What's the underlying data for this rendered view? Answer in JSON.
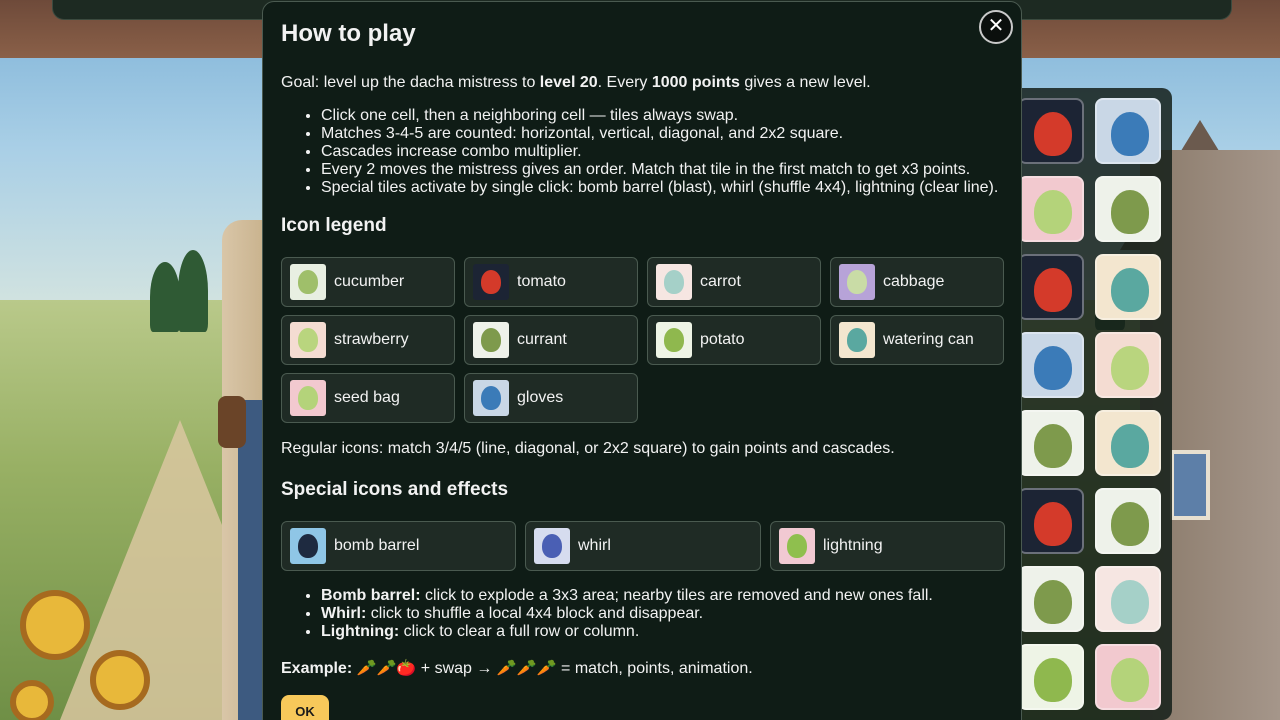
{
  "modal": {
    "title": "How to play",
    "close_label": "✕",
    "goal": {
      "prefix": "Goal: level up the dacha mistress to ",
      "level": "level 20",
      "middle": ". Every ",
      "points": "1000 points",
      "suffix": " gives a new level."
    },
    "rules": [
      "Click one cell, then a neighboring cell — tiles always swap.",
      "Matches 3-4-5 are counted: horizontal, vertical, diagonal, and 2x2 square.",
      "Cascades increase combo multiplier.",
      "Every 2 moves the mistress gives an order. Match that tile in the first match to get x3 points.",
      "Special tiles activate by single click: bomb barrel (blast), whirl (shuffle 4x4), lightning (clear line)."
    ],
    "legend_title": "Icon legend",
    "legend": [
      {
        "label": "cucumber",
        "bg": "#e8efe2",
        "color": "#9fbf6a",
        "icon": "cucumber-icon"
      },
      {
        "label": "tomato",
        "bg": "#1c2434",
        "color": "#d43a2a",
        "icon": "tomato-icon"
      },
      {
        "label": "carrot",
        "bg": "#f6e6e2",
        "color": "#a5d0c8",
        "icon": "carrot-icon"
      },
      {
        "label": "cabbage",
        "bg": "#b7a3d8",
        "color": "#c9dca6",
        "icon": "cabbage-icon"
      },
      {
        "label": "strawberry",
        "bg": "#f4dcd2",
        "color": "#b9d57e",
        "icon": "strawberry-icon"
      },
      {
        "label": "currant",
        "bg": "#eef2ea",
        "color": "#7e9a4c",
        "icon": "currant-icon"
      },
      {
        "label": "potato",
        "bg": "#eef4e6",
        "color": "#8fb84e",
        "icon": "potato-icon"
      },
      {
        "label": "watering can",
        "bg": "#f3e6cf",
        "color": "#5aa8a0",
        "icon": "watering-can-icon"
      },
      {
        "label": "seed bag",
        "bg": "#f2c9cf",
        "color": "#b4d37a",
        "icon": "seed-bag-icon"
      },
      {
        "label": "gloves",
        "bg": "#c9d7e6",
        "color": "#3b7bb8",
        "icon": "gloves-icon"
      }
    ],
    "regular_text": "Regular icons: match 3/4/5 (line, diagonal, or 2x2 square) to gain points and cascades.",
    "special_title": "Special icons and effects",
    "specials": [
      {
        "label": "bomb barrel",
        "bg": "#8fc6e6",
        "color": "#1e2a40",
        "icon": "bomb-barrel-icon"
      },
      {
        "label": "whirl",
        "bg": "#d6dcef",
        "color": "#4a5fb4",
        "icon": "whirl-icon"
      },
      {
        "label": "lightning",
        "bg": "#f1c9d2",
        "color": "#8fbf4e",
        "icon": "lightning-icon"
      }
    ],
    "effects": [
      {
        "name": "Bomb barrel:",
        "text": " click to explode a 3x3 area; nearby tiles are removed and new ones fall."
      },
      {
        "name": "Whirl:",
        "text": " click to shuffle a local 4x4 block and disappear."
      },
      {
        "name": "Lightning:",
        "text": " click to clear a full row or column."
      }
    ],
    "example": {
      "label": "Example:",
      "before": " 🥕🥕🍅 + swap → 🥕🥕🥕 = match, points, animation."
    },
    "ok_label": "OK"
  },
  "board_tiles": [
    {
      "icon": "tomato-icon",
      "bg": "#1c2434",
      "color": "#d43a2a"
    },
    {
      "icon": "gloves-icon",
      "bg": "#c9d7e6",
      "color": "#3b7bb8"
    },
    {
      "icon": "seed-bag-icon",
      "bg": "#f2c9cf",
      "color": "#b4d37a"
    },
    {
      "icon": "currant-icon",
      "bg": "#eef2ea",
      "color": "#7e9a4c"
    },
    {
      "icon": "tomato-icon",
      "bg": "#1c2434",
      "color": "#d43a2a"
    },
    {
      "icon": "watering-can-icon",
      "bg": "#f3e6cf",
      "color": "#5aa8a0"
    },
    {
      "icon": "gloves-icon",
      "bg": "#c9d7e6",
      "color": "#3b7bb8"
    },
    {
      "icon": "strawberry-icon",
      "bg": "#f4dcd2",
      "color": "#b9d57e"
    },
    {
      "icon": "currant-icon",
      "bg": "#eef2ea",
      "color": "#7e9a4c"
    },
    {
      "icon": "watering-can-icon",
      "bg": "#f3e6cf",
      "color": "#5aa8a0"
    },
    {
      "icon": "tomato-icon",
      "bg": "#1c2434",
      "color": "#d43a2a"
    },
    {
      "icon": "currant-icon",
      "bg": "#eef2ea",
      "color": "#7e9a4c"
    },
    {
      "icon": "currant-icon",
      "bg": "#eef2ea",
      "color": "#7e9a4c"
    },
    {
      "icon": "carrot-icon",
      "bg": "#f6e6e2",
      "color": "#a5d0c8"
    },
    {
      "icon": "potato-icon",
      "bg": "#eef4e6",
      "color": "#8fb84e"
    },
    {
      "icon": "seed-bag-icon",
      "bg": "#f2c9cf",
      "color": "#b4d37a"
    }
  ]
}
